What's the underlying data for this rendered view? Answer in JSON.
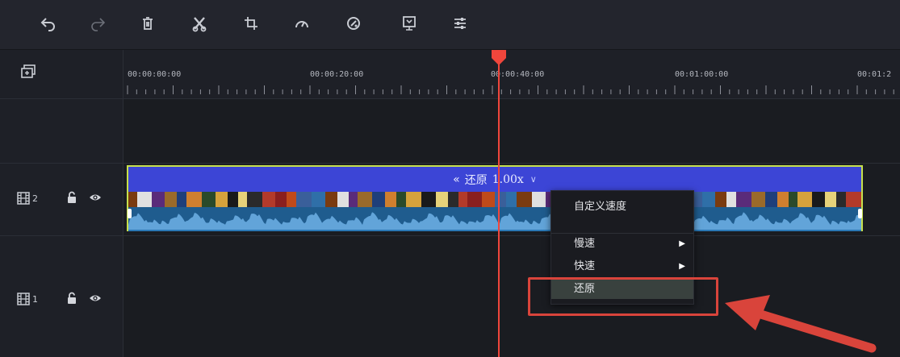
{
  "toolbar": {
    "tools": [
      {
        "name": "undo-icon",
        "enabled": true
      },
      {
        "name": "redo-icon",
        "enabled": false
      },
      {
        "name": "delete-icon",
        "enabled": true
      },
      {
        "name": "split-icon",
        "enabled": true
      },
      {
        "name": "crop-icon",
        "enabled": true
      },
      {
        "name": "speed-icon",
        "enabled": true
      },
      {
        "name": "color-icon",
        "enabled": true
      },
      {
        "name": "green-screen-icon",
        "enabled": true
      },
      {
        "name": "adjust-icon",
        "enabled": true
      }
    ]
  },
  "ruler": {
    "labels": [
      "00:00:00:00",
      "00:00:20:00",
      "00:00:40:00",
      "00:01:00:00",
      "00:01:2"
    ]
  },
  "tracks": {
    "track2": {
      "number": "2"
    },
    "track1": {
      "number": "1"
    }
  },
  "clip": {
    "speed_prefix": "«",
    "speed_label": "还原",
    "speed_value": "1.00x",
    "speed_dropdown": "∨"
  },
  "context_menu": {
    "items": [
      {
        "label": "自定义速度",
        "has_submenu": false
      },
      {
        "label": "慢速",
        "has_submenu": true
      },
      {
        "label": "快速",
        "has_submenu": true
      },
      {
        "label": "还原",
        "has_submenu": false,
        "highlighted": true
      }
    ],
    "submenu_arrow": "▶"
  },
  "colors": {
    "playhead": "#f0463c",
    "speed_bar": "#3c45d6",
    "clip_border": "#c7e04c",
    "annotation": "#d9443b"
  }
}
